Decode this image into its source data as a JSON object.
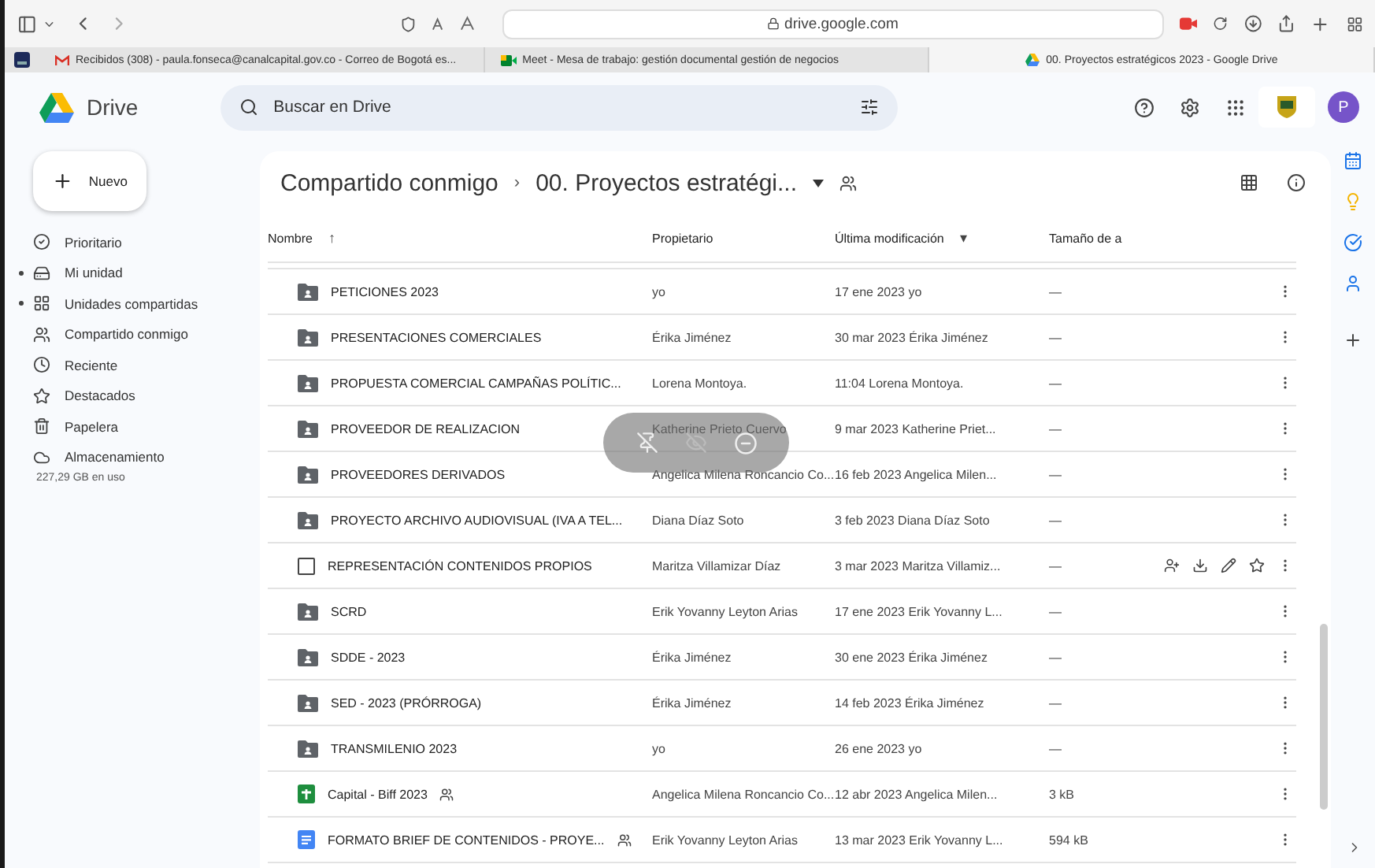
{
  "browser": {
    "url": "drive.google.com",
    "tabs": [
      {
        "kind": "gmail",
        "title": "Recibidos (308) - paula.fonseca@canalcapital.gov.co - Correo de Bogotá es...",
        "selected": false
      },
      {
        "kind": "meet",
        "title": "Meet - Mesa de trabajo: gestión documental gestión de negocios",
        "selected": false
      },
      {
        "kind": "drive",
        "title": "00. Proyectos estratégicos 2023 - Google Drive",
        "selected": true
      }
    ]
  },
  "header": {
    "brand": "Drive",
    "search": {
      "placeholder": "Buscar en Drive"
    },
    "avatar": "P"
  },
  "sidebar": {
    "new_button": "Nuevo",
    "items": [
      {
        "kind": "priority",
        "label": "Prioritario",
        "expandable": false
      },
      {
        "kind": "drive",
        "label": "Mi unidad",
        "expandable": true
      },
      {
        "kind": "shared_drives",
        "label": "Unidades compartidas",
        "expandable": true
      },
      {
        "kind": "shared",
        "label": "Compartido conmigo",
        "expandable": false
      },
      {
        "kind": "recent",
        "label": "Reciente",
        "expandable": false
      },
      {
        "kind": "starred",
        "label": "Destacados",
        "expandable": false
      },
      {
        "kind": "trash",
        "label": "Papelera",
        "expandable": false
      },
      {
        "kind": "storage",
        "label": "Almacenamiento",
        "expandable": false
      }
    ],
    "storage_usage": "227,29 GB en uso"
  },
  "breadcrumb": {
    "separator": "›",
    "items": [
      "Compartido conmigo",
      "00. Proyectos estratégi..."
    ]
  },
  "table": {
    "columns": [
      {
        "label": "Nombre",
        "arrow": "↑"
      },
      {
        "label": "Propietario"
      },
      {
        "label": "Última modificación",
        "arrow": "▾"
      },
      {
        "label": "Tamaño de a"
      }
    ],
    "rows": [
      {
        "kind": "folder",
        "name": "PETICIONES  2023",
        "shared": false,
        "owner": "yo",
        "modified": "17 ene 2023 yo",
        "size": "—",
        "hovered": false
      },
      {
        "kind": "folder",
        "name": "PRESENTACIONES COMERCIALES",
        "shared": false,
        "owner": "Érika Jiménez",
        "modified": "30 mar 2023 Érika Jiménez",
        "size": "—",
        "hovered": false
      },
      {
        "kind": "folder",
        "name": "PROPUESTA COMERCIAL CAMPAÑAS POLÍTIC...",
        "shared": false,
        "owner": "Lorena Montoya.",
        "modified": "11:04 Lorena Montoya.",
        "size": "—",
        "hovered": false
      },
      {
        "kind": "folder",
        "name": "PROVEEDOR DE REALIZACION",
        "shared": false,
        "owner": "Katherine Prieto Cuervo",
        "modified": "9 mar 2023 Katherine Priet...",
        "size": "—",
        "hovered": false
      },
      {
        "kind": "folder",
        "name": "PROVEEDORES DERIVADOS",
        "shared": false,
        "owner": "Angelica Milena Roncancio Co...",
        "modified": "16 feb 2023 Angelica Milen...",
        "size": "—",
        "hovered": false
      },
      {
        "kind": "folder",
        "name": "PROYECTO ARCHIVO AUDIOVISUAL (IVA A TEL...",
        "shared": false,
        "owner": "Diana Díaz Soto",
        "modified": "3 feb 2023 Diana Díaz Soto",
        "size": "—",
        "hovered": false
      },
      {
        "kind": "checkbox",
        "name": "REPRESENTACIÓN CONTENIDOS PROPIOS",
        "shared": false,
        "owner": "Maritza Villamizar Díaz",
        "modified": "3 mar 2023 Maritza Villamiz...",
        "size": "—",
        "hovered": true,
        "checked": false
      },
      {
        "kind": "folder",
        "name": "SCRD",
        "shared": false,
        "owner": "Erik Yovanny Leyton Arias",
        "modified": "17 ene 2023 Erik Yovanny L...",
        "size": "—",
        "hovered": false
      },
      {
        "kind": "folder",
        "name": "SDDE - 2023",
        "shared": false,
        "owner": "Érika Jiménez",
        "modified": "30 ene 2023 Érika Jiménez",
        "size": "—",
        "hovered": false
      },
      {
        "kind": "folder",
        "name": "SED - 2023 (PRÓRROGA)",
        "shared": false,
        "owner": "Érika Jiménez",
        "modified": "14 feb 2023 Érika Jiménez",
        "size": "—",
        "hovered": false
      },
      {
        "kind": "folder",
        "name": "TRANSMILENIO  2023",
        "shared": false,
        "owner": "yo",
        "modified": "26 ene 2023 yo",
        "size": "—",
        "hovered": false
      },
      {
        "kind": "sheet",
        "name": "Capital - Biff 2023",
        "shared": true,
        "owner": "Angelica Milena Roncancio Co...",
        "modified": "12 abr 2023 Angelica Milen...",
        "size": "3 kB",
        "hovered": false
      },
      {
        "kind": "doc",
        "name": "FORMATO BRIEF DE CONTENIDOS - PROYE...",
        "shared": true,
        "owner": "Erik Yovanny Leyton Arias",
        "modified": "13 mar 2023 Erik Yovanny L...",
        "size": "594 kB",
        "hovered": false
      }
    ]
  }
}
